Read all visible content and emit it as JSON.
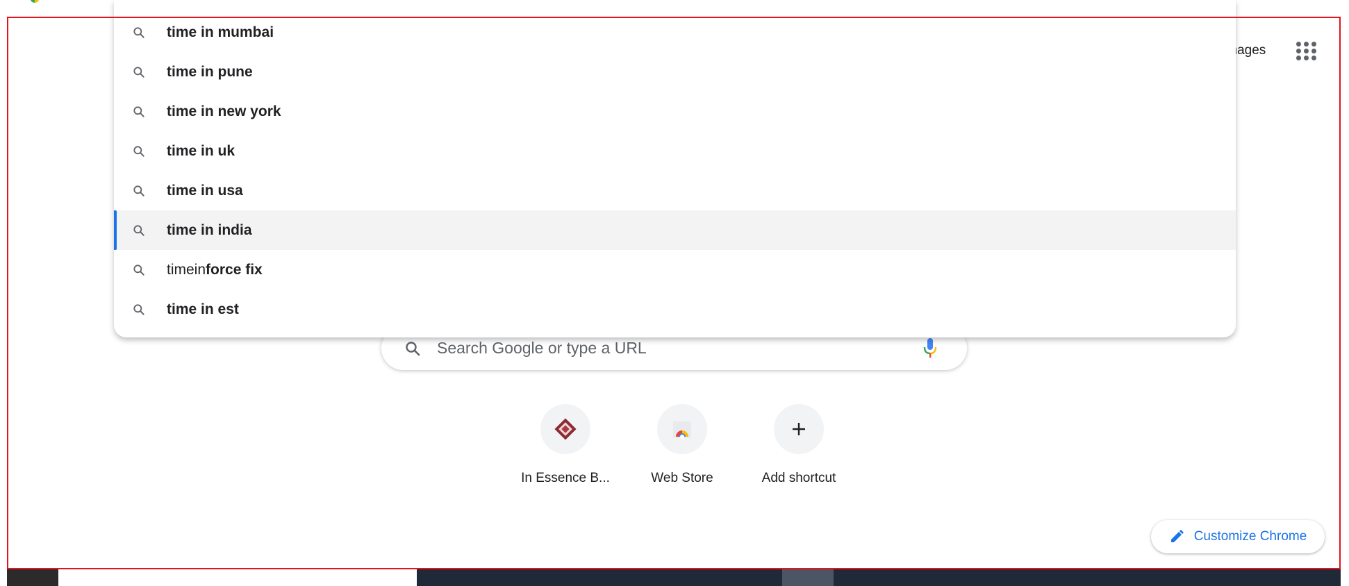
{
  "header": {
    "images_label": "Images",
    "apps_icon": "apps-grid-icon"
  },
  "suggestions": [
    {
      "prefix": "",
      "bold": "time in mumbai",
      "selected": false
    },
    {
      "prefix": "",
      "bold": "time in pune",
      "selected": false
    },
    {
      "prefix": "",
      "bold": "time in new york",
      "selected": false
    },
    {
      "prefix": "",
      "bold": "time in uk",
      "selected": false
    },
    {
      "prefix": "",
      "bold": "time in usa",
      "selected": false
    },
    {
      "prefix": "",
      "bold": "time in india",
      "selected": true
    },
    {
      "prefix": "timein",
      "bold": "force fix",
      "selected": false
    },
    {
      "prefix": "",
      "bold": "time in est",
      "selected": false
    }
  ],
  "search": {
    "placeholder": "Search Google or type a URL",
    "search_icon": "search-icon",
    "mic_icon": "microphone-icon"
  },
  "shortcuts": [
    {
      "label": "In Essence B...",
      "icon": "in-essence-favicon"
    },
    {
      "label": "Web Store",
      "icon": "web-store-icon"
    },
    {
      "label": "Add shortcut",
      "icon": "plus-icon"
    }
  ],
  "customize": {
    "label": "Customize Chrome",
    "icon": "pencil-icon"
  },
  "colors": {
    "accent": "#1a73e8",
    "frame": "#e3141c"
  }
}
